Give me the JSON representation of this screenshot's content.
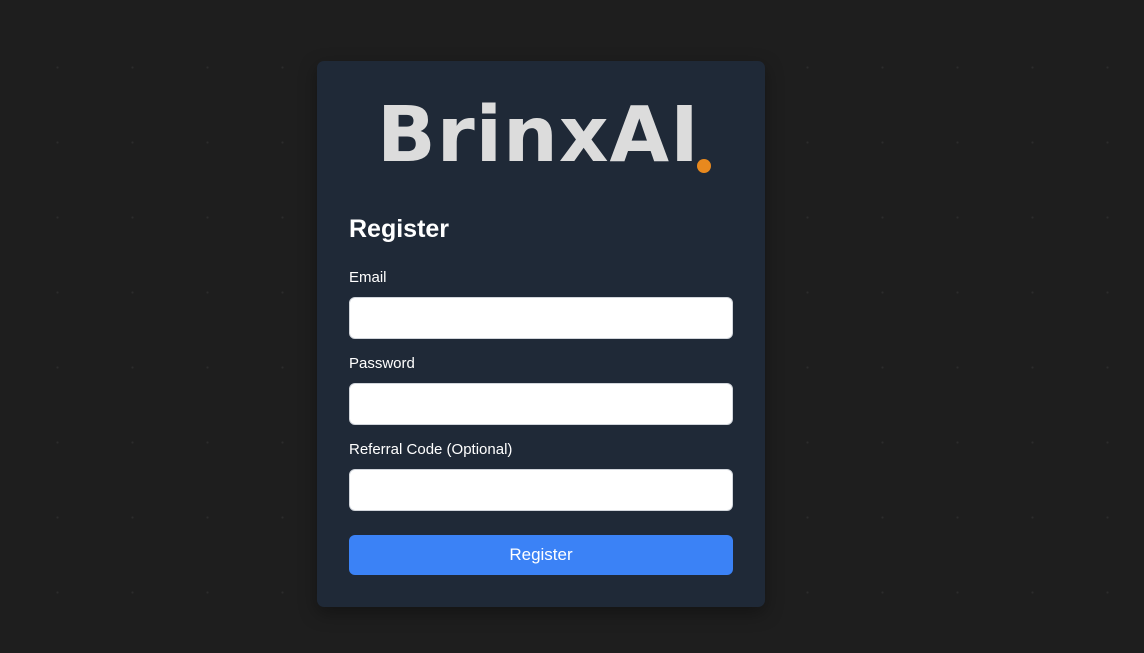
{
  "logo": {
    "text": "BrinxAI",
    "dot_color": "#e8891e"
  },
  "form": {
    "title": "Register",
    "fields": [
      {
        "label": "Email",
        "value": "",
        "placeholder": ""
      },
      {
        "label": "Password",
        "value": "",
        "placeholder": ""
      },
      {
        "label": "Referral Code (Optional)",
        "value": "",
        "placeholder": ""
      }
    ],
    "submit_label": "Register",
    "submit_color": "#3b82f6"
  }
}
